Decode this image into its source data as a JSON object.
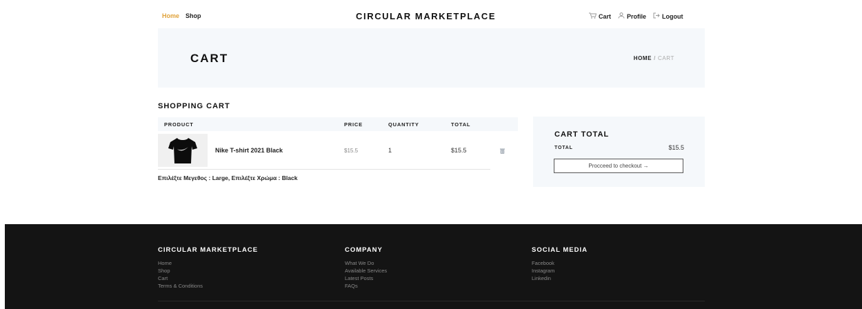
{
  "header": {
    "nav_left": [
      "Home",
      "Shop"
    ],
    "brand": "CIRCULAR MARKETPLACE",
    "nav_right": [
      {
        "icon": "cart-icon",
        "label": "Cart"
      },
      {
        "icon": "profile-icon",
        "label": "Profile"
      },
      {
        "icon": "logout-icon",
        "label": "Logout"
      }
    ]
  },
  "hero": {
    "title": "CART",
    "breadcrumb_home": "HOME",
    "breadcrumb_sep": "/",
    "breadcrumb_current": "CART"
  },
  "cart": {
    "title": "SHOPPING CART",
    "columns": [
      "PRODUCT",
      "PRICE",
      "QUANTITY",
      "TOTAL"
    ],
    "items": [
      {
        "name": "Nike T-shirt 2021 Black",
        "price": "$15.5",
        "quantity": "1",
        "total": "$15.5",
        "variant": "Επιλέξτε Μεγεθος : Large, Επιλέξτε Χρώμα : Black"
      }
    ]
  },
  "totals": {
    "title": "CART TOTAL",
    "label": "TOTAL",
    "value": "$15.5",
    "button": "Procceed to checkout →"
  },
  "footer": {
    "columns": [
      {
        "title": "CIRCULAR MARKETPLACE",
        "links": [
          "Home",
          "Shop",
          "Cart",
          "Terms & Conditions"
        ]
      },
      {
        "title": "COMPANY",
        "links": [
          "What We Do",
          "Available Services",
          "Latest Posts",
          "FAQs"
        ]
      },
      {
        "title": "SOCIAL MEDIA",
        "links": [
          "Facebook",
          "Instagram",
          "Linkedin"
        ]
      }
    ]
  },
  "colors": {
    "accent": "#e0a23a",
    "panel": "#f5f8fb",
    "footer": "#141414"
  }
}
